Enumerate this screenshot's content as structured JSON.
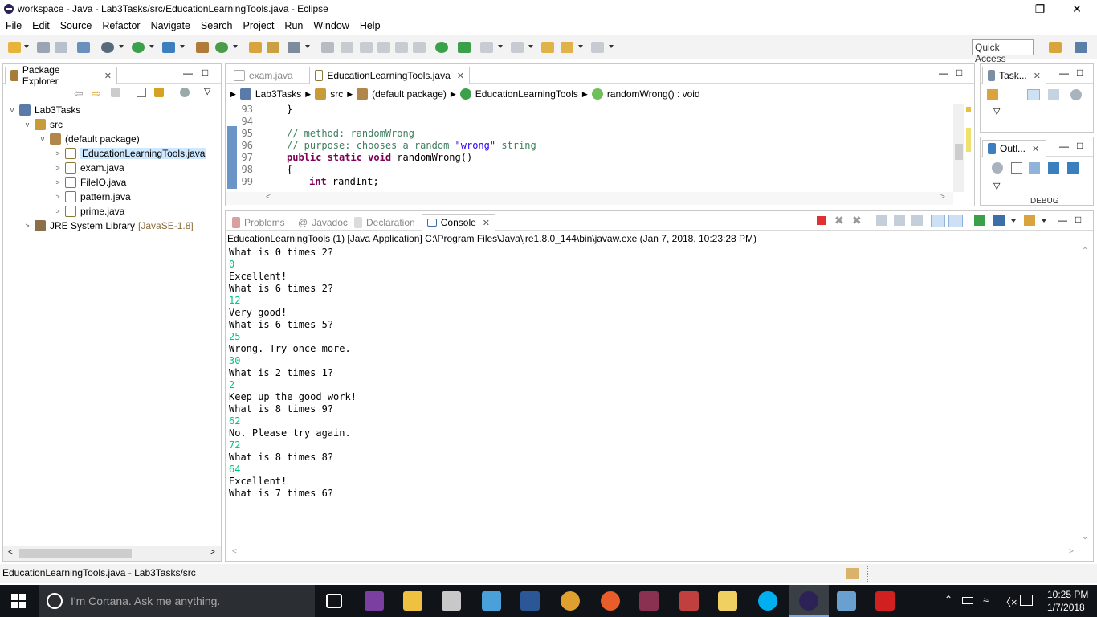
{
  "window": {
    "title": "workspace - Java - Lab3Tasks/src/EducationLearningTools.java - Eclipse"
  },
  "menu": [
    "File",
    "Edit",
    "Source",
    "Refactor",
    "Navigate",
    "Search",
    "Project",
    "Run",
    "Window",
    "Help"
  ],
  "toolbar": {
    "quick_access": "Quick Access"
  },
  "package_explorer": {
    "tab_label": "Package Explorer",
    "tree": [
      {
        "label": "Lab3Tasks",
        "depth": 0,
        "twisty": "v"
      },
      {
        "label": "src",
        "depth": 1,
        "twisty": "v"
      },
      {
        "label": "(default package)",
        "depth": 2,
        "twisty": "v"
      },
      {
        "label": "EducationLearningTools.java",
        "depth": 3,
        "twisty": ">"
      },
      {
        "label": "exam.java",
        "depth": 3,
        "twisty": ">"
      },
      {
        "label": "FileIO.java",
        "depth": 3,
        "twisty": ">"
      },
      {
        "label": "pattern.java",
        "depth": 3,
        "twisty": ">"
      },
      {
        "label": "prime.java",
        "depth": 3,
        "twisty": ">"
      }
    ],
    "jre_label": "JRE System Library",
    "jre_version": "[JavaSE-1.8]"
  },
  "editor": {
    "tabs": [
      {
        "label": "exam.java"
      },
      {
        "label": "EducationLearningTools.java"
      }
    ],
    "breadcrumb": [
      "Lab3Tasks",
      "src",
      "(default package)",
      "EducationLearningTools",
      "randomWrong() : void"
    ],
    "line_numbers": [
      "93",
      "94",
      "95",
      "96",
      "97",
      "98",
      "99"
    ],
    "code": {
      "l93": "}",
      "l95": "// method: randomWrong",
      "l96_comment": "// purpose: chooses a random ",
      "l96_str": "\"wrong\"",
      "l96_tail": " string",
      "l97_kw": "public static void",
      "l97_rest": " randomWrong()",
      "l98": "{",
      "l99_kw": "int",
      "l99_rest": " randInt;"
    }
  },
  "right_panels": {
    "tasks_label": "Task...",
    "outline_label": "Outl...",
    "debug_label": "DEBUG"
  },
  "console": {
    "tabs": [
      "Problems",
      "Javadoc",
      "Declaration",
      "Console"
    ],
    "header": "EducationLearningTools (1) [Java Application] C:\\Program Files\\Java\\jre1.8.0_144\\bin\\javaw.exe (Jan 7, 2018, 10:23:28 PM)",
    "lines": [
      {
        "text": "What is 0 times 2?",
        "input": false
      },
      {
        "text": "0",
        "input": true
      },
      {
        "text": "Excellent!",
        "input": false
      },
      {
        "text": "What is 6 times 2?",
        "input": false
      },
      {
        "text": "12",
        "input": true
      },
      {
        "text": "Very good!",
        "input": false
      },
      {
        "text": "What is 6 times 5?",
        "input": false
      },
      {
        "text": "25",
        "input": true
      },
      {
        "text": "Wrong. Try once more.",
        "input": false
      },
      {
        "text": "30",
        "input": true
      },
      {
        "text": "What is 2 times 1?",
        "input": false
      },
      {
        "text": "2",
        "input": true
      },
      {
        "text": "Keep up the good work!",
        "input": false
      },
      {
        "text": "What is 8 times 9?",
        "input": false
      },
      {
        "text": "62",
        "input": true
      },
      {
        "text": "No. Please try again.",
        "input": false
      },
      {
        "text": "72",
        "input": true
      },
      {
        "text": "What is 8 times 8?",
        "input": false
      },
      {
        "text": "64",
        "input": true
      },
      {
        "text": "Excellent!",
        "input": false
      },
      {
        "text": "What is 7 times 6?",
        "input": false
      }
    ]
  },
  "status": {
    "selection": "EducationLearningTools.java - Lab3Tasks/src"
  },
  "taskbar": {
    "cortana": "I'm Cortana. Ask me anything.",
    "time": "10:25 PM",
    "date": "1/7/2018"
  },
  "colors": {
    "console_input": "#00c87d",
    "comment": "#3f7f5f",
    "keyword": "#7f0055",
    "string": "#2a00ff",
    "taskbar": "#101418"
  }
}
